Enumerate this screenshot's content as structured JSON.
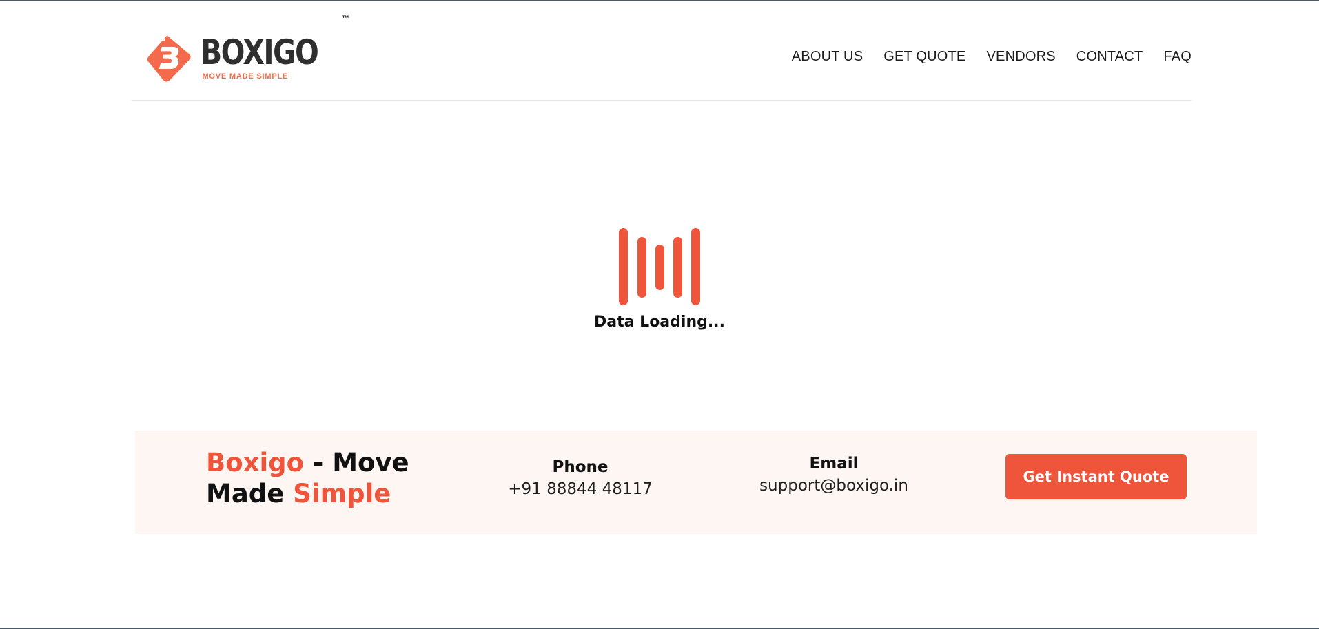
{
  "header": {
    "logo": {
      "name": "BOXIGO",
      "tagline": "MOVE MADE SIMPLE",
      "trademark": "™",
      "mark_icon": "boxigo-b-mark-icon",
      "brand_color": "#f36a4c"
    },
    "nav": [
      {
        "label": "ABOUT US"
      },
      {
        "label": "GET QUOTE"
      },
      {
        "label": "VENDORS"
      },
      {
        "label": "CONTACT"
      },
      {
        "label": "FAQ"
      }
    ]
  },
  "loader": {
    "icon": "loading-bars-icon",
    "text": "Data Loading...",
    "color": "#ef553b"
  },
  "footer": {
    "brand": {
      "word1": "Boxigo",
      "word2": " - Move",
      "word3": "Made ",
      "word4": "Simple"
    },
    "phone": {
      "label": "Phone",
      "value": "+91 88844 48117"
    },
    "email": {
      "label": "Email",
      "value": "support@boxigo.in"
    },
    "cta_label": "Get Instant Quote",
    "accent_color": "#ef553b",
    "band_color": "#fdf6f3"
  }
}
